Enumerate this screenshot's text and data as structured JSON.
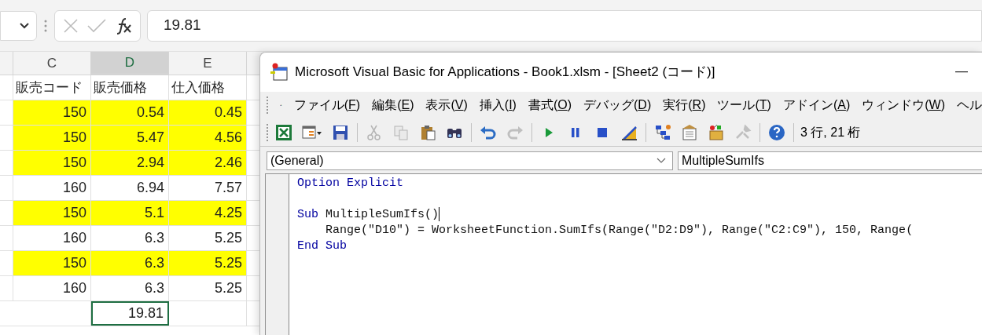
{
  "formula_bar": {
    "value": "19.81"
  },
  "columns": [
    {
      "label": "C",
      "selected": false
    },
    {
      "label": "D",
      "selected": true
    },
    {
      "label": "E",
      "selected": false
    }
  ],
  "rows": [
    {
      "cells": [
        "販売コード",
        "販売価格",
        "仕入価格"
      ],
      "highlighted": false
    },
    {
      "cells": [
        "150",
        "0.54",
        "0.45"
      ],
      "highlighted": true
    },
    {
      "cells": [
        "150",
        "5.47",
        "4.56"
      ],
      "highlighted": true
    },
    {
      "cells": [
        "150",
        "2.94",
        "2.46"
      ],
      "highlighted": true
    },
    {
      "cells": [
        "160",
        "6.94",
        "7.57"
      ],
      "highlighted": false
    },
    {
      "cells": [
        "150",
        "5.1",
        "4.25"
      ],
      "highlighted": true
    },
    {
      "cells": [
        "160",
        "6.3",
        "5.25"
      ],
      "highlighted": false
    },
    {
      "cells": [
        "150",
        "6.3",
        "5.25"
      ],
      "highlighted": true
    },
    {
      "cells": [
        "160",
        "6.3",
        "5.25"
      ],
      "highlighted": false
    }
  ],
  "total_cell": {
    "value": "19.81",
    "selected": true
  },
  "vba_window": {
    "title": "Microsoft Visual Basic for Applications - Book1.xlsm - [Sheet2 (コード)]",
    "menu": [
      "ファイル(F)",
      "編集(E)",
      "表示(V)",
      "挿入(I)",
      "書式(O)",
      "デバッグ(D)",
      "実行(R)",
      "ツール(T)",
      "アドイン(A)",
      "ウィンドウ(W)",
      "ヘル"
    ],
    "toolbar": [
      {
        "kind": "excel",
        "disabled": false
      },
      {
        "kind": "userform",
        "disabled": false
      },
      {
        "kind": "save",
        "disabled": false
      },
      {
        "kind": "separator"
      },
      {
        "kind": "cut",
        "disabled": true
      },
      {
        "kind": "copy",
        "disabled": true
      },
      {
        "kind": "paste",
        "disabled": false
      },
      {
        "kind": "find",
        "disabled": false
      },
      {
        "kind": "separator"
      },
      {
        "kind": "undo",
        "disabled": false
      },
      {
        "kind": "redo",
        "disabled": true
      },
      {
        "kind": "separator"
      },
      {
        "kind": "run",
        "disabled": false
      },
      {
        "kind": "pause",
        "disabled": false
      },
      {
        "kind": "stop",
        "disabled": false
      },
      {
        "kind": "design",
        "disabled": false
      },
      {
        "kind": "separator"
      },
      {
        "kind": "project",
        "disabled": false
      },
      {
        "kind": "properties",
        "disabled": false
      },
      {
        "kind": "objectbrowser",
        "disabled": false
      },
      {
        "kind": "toolbox",
        "disabled": true
      },
      {
        "kind": "separator"
      },
      {
        "kind": "help",
        "disabled": false
      },
      {
        "kind": "separator"
      }
    ],
    "position": "3 行, 21 桁",
    "object_dropdown": "(General)",
    "procedure_dropdown": "MultipleSumIfs",
    "code": [
      {
        "kind": "code",
        "cursor": false,
        "segments": [
          {
            "kind": "keyword",
            "text": "Option Explicit"
          }
        ]
      },
      {
        "kind": "blank"
      },
      {
        "kind": "code",
        "cursor": true,
        "segments": [
          {
            "kind": "keyword",
            "text": "Sub"
          },
          {
            "kind": "plain",
            "text": " MultipleSumIfs()"
          }
        ]
      },
      {
        "kind": "code",
        "cursor": false,
        "segments": [
          {
            "kind": "plain",
            "text": "    Range(\"D10\") = WorksheetFunction.SumIfs(Range(\"D2:D9\"), Range(\"C2:C9\"), 150, Range("
          }
        ]
      },
      {
        "kind": "code",
        "cursor": false,
        "segments": [
          {
            "kind": "keyword",
            "text": "End Sub"
          }
        ]
      }
    ]
  }
}
